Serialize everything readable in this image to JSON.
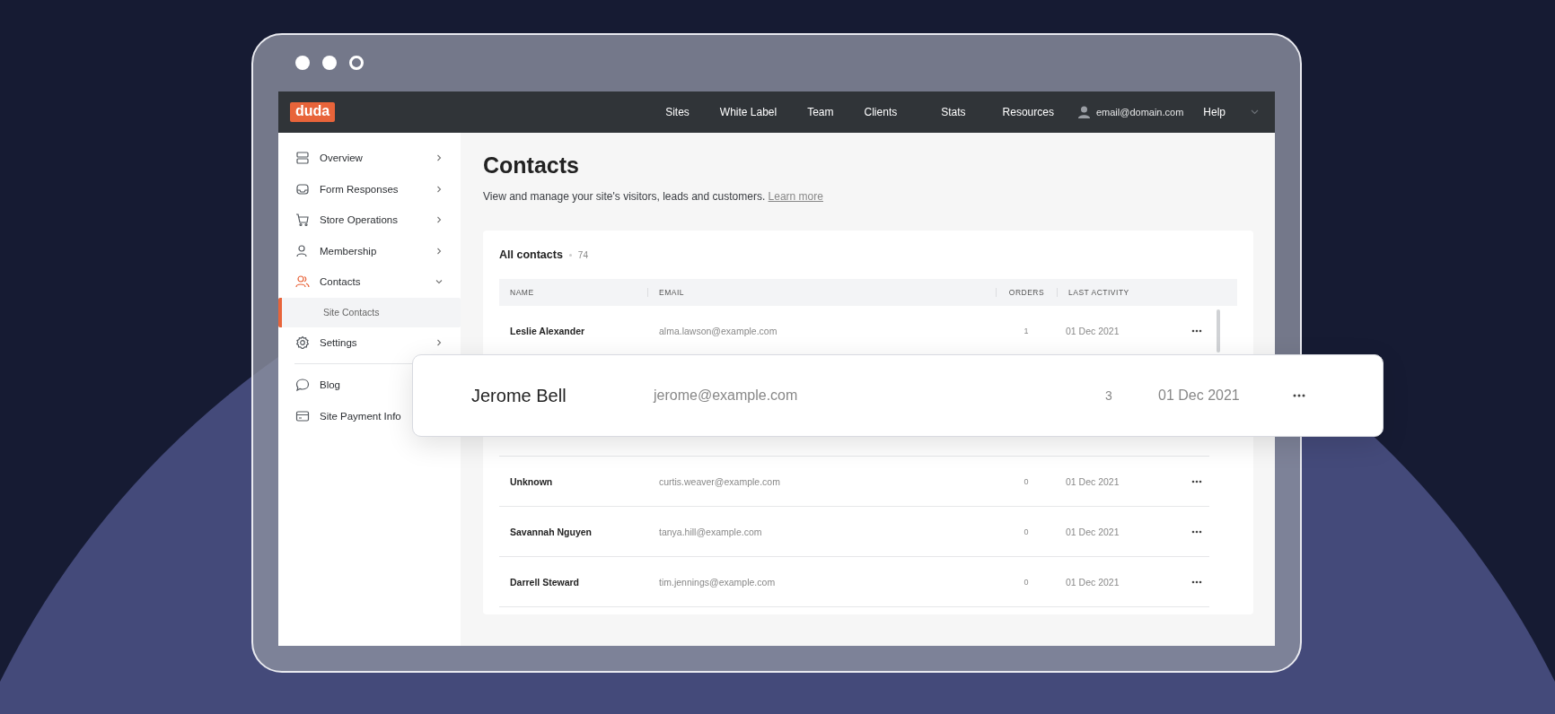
{
  "window": {
    "controls": [
      {
        "kind": "filled"
      },
      {
        "kind": "filled"
      },
      {
        "kind": "outline"
      }
    ]
  },
  "topbar": {
    "logo": "duda",
    "nav": [
      "Sites",
      "White Label",
      "Team",
      "Clients",
      "Stats",
      "Resources"
    ],
    "account": "email@domain.com",
    "help": "Help"
  },
  "sidebar": {
    "sections": [
      {
        "items": [
          {
            "label": "Overview",
            "kind": "layers",
            "selected": false,
            "expanded": false
          },
          {
            "label": "Form Responses",
            "kind": "inbox",
            "selected": false,
            "expanded": false
          },
          {
            "label": "Store Operations",
            "kind": "cart",
            "selected": false,
            "expanded": false
          },
          {
            "label": "Membership",
            "kind": "person",
            "selected": false,
            "expanded": false
          },
          {
            "label": "Contacts",
            "kind": "people",
            "selected": true,
            "expanded": true,
            "children": [
              {
                "label": "Site Contacts",
                "selected": true
              }
            ]
          },
          {
            "label": "Settings",
            "kind": "gear",
            "selected": false,
            "expanded": false
          }
        ]
      },
      {
        "items": [
          {
            "label": "Blog",
            "kind": "chat",
            "selected": false
          },
          {
            "label": "Site Payment Info",
            "kind": "card",
            "selected": false
          }
        ]
      }
    ]
  },
  "page": {
    "title": "Contacts",
    "description": "View and manage your site's visitors, leads and customers.",
    "link": "Learn more"
  },
  "contacts": {
    "title": "All contacts",
    "count": "74",
    "columns": [
      "NAME",
      "EMAIL",
      "ORDERS",
      "LAST ACTIVITY"
    ],
    "rows": [
      {
        "name": "Leslie Alexander",
        "email": "alma.lawson@example.com",
        "orders": "1",
        "last_activity": "01 Dec 2021"
      },
      {
        "name": "Unknown",
        "email": "curtis.weaver@example.com",
        "orders": "0",
        "last_activity": "01 Dec 2021"
      },
      {
        "name": "Savannah Nguyen",
        "email": "tanya.hill@example.com",
        "orders": "0",
        "last_activity": "01 Dec 2021"
      },
      {
        "name": "Darrell Steward",
        "email": "tim.jennings@example.com",
        "orders": "0",
        "last_activity": "01 Dec 2021"
      }
    ],
    "highlighted_row": {
      "name": "Jerome Bell",
      "email": "jerome@example.com",
      "orders": "3",
      "last_activity": "01 Dec 2021"
    }
  }
}
